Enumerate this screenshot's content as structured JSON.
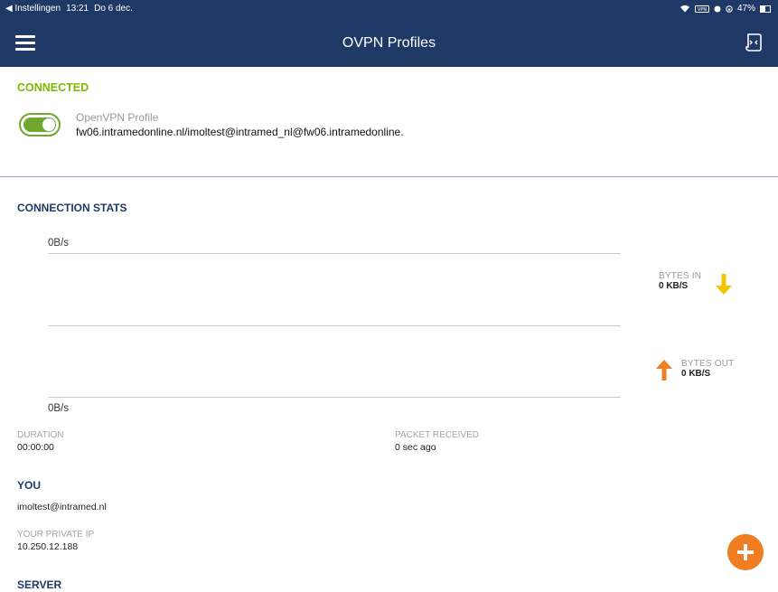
{
  "status_bar": {
    "back_app": "◀ Instellingen",
    "time": "13:21",
    "date": "Do 6 dec.",
    "battery": "47%"
  },
  "header": {
    "title": "OVPN Profiles"
  },
  "connection": {
    "status_label": "CONNECTED",
    "toggle_on": true,
    "profile_name": "OpenVPN Profile",
    "profile_detail": "fw06.intramedonline.nl/imoltest@intramed_nl@fw06.intramedonline."
  },
  "stats": {
    "title": "CONNECTION STATS",
    "graph_top_label": "0B/s",
    "graph_bottom_label": "0B/s",
    "bytes_in_label": "BYTES IN",
    "bytes_in_value": "0 KB/S",
    "bytes_out_label": "BYTES OUT",
    "bytes_out_value": "0 KB/S",
    "duration_label": "DURATION",
    "duration_value": "00:00:00",
    "packet_label": "PACKET RECEIVED",
    "packet_value": "0 sec ago"
  },
  "you": {
    "title": "YOU",
    "user": "imoltest@intramed.nl",
    "private_ip_label": "YOUR PRIVATE IP",
    "private_ip_value": "10.250.12.188"
  },
  "server": {
    "title": "SERVER"
  },
  "colors": {
    "header_bg": "#1f3966",
    "connected_green": "#7dbb00",
    "toggle_green": "#6fa82d",
    "bytes_in_arrow": "#f5c400",
    "bytes_out_arrow": "#ef7d22",
    "fab_orange": "#ef7d22"
  },
  "icons": {
    "menu": "hamburger-icon",
    "import": "import-profile-icon",
    "bytes_in": "arrow-down-icon",
    "bytes_out": "arrow-up-icon",
    "fab": "plus-icon"
  }
}
